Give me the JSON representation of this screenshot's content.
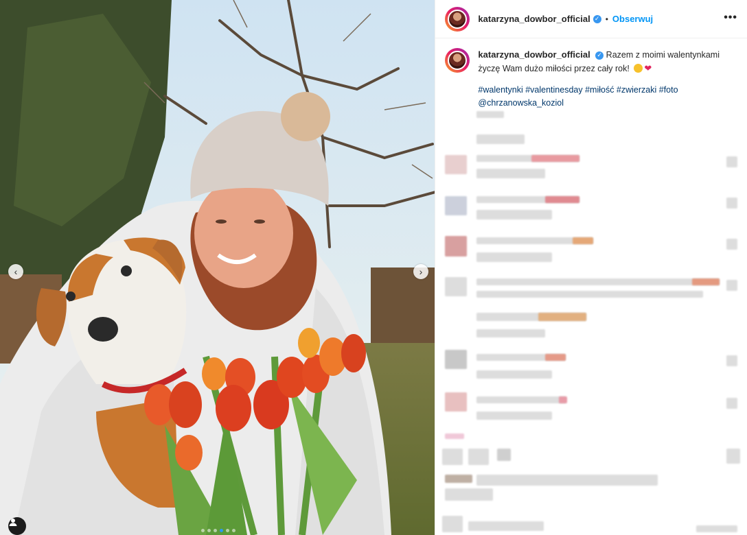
{
  "post": {
    "username": "katarzyna_dowbor_official",
    "follow_label": "Obserwuj",
    "separator": "•",
    "more_label": "•••"
  },
  "caption": {
    "text": "Razem z moimi walentynkami życzę Wam dużo miłości przez cały rok!",
    "hashtags": "#walentynki #valentinesday #miłość #zwierzaki #foto",
    "mention": "@chrzanowska_koziol"
  },
  "carousel": {
    "slides": 6,
    "active_slide": 4
  },
  "colors": {
    "accent": "#0095f6",
    "verified": "#3897f0",
    "hashtag": "#00376b"
  },
  "icons": [
    "chevron-left-icon",
    "chevron-right-icon",
    "user-tag-icon",
    "verified-icon",
    "more-icon"
  ]
}
